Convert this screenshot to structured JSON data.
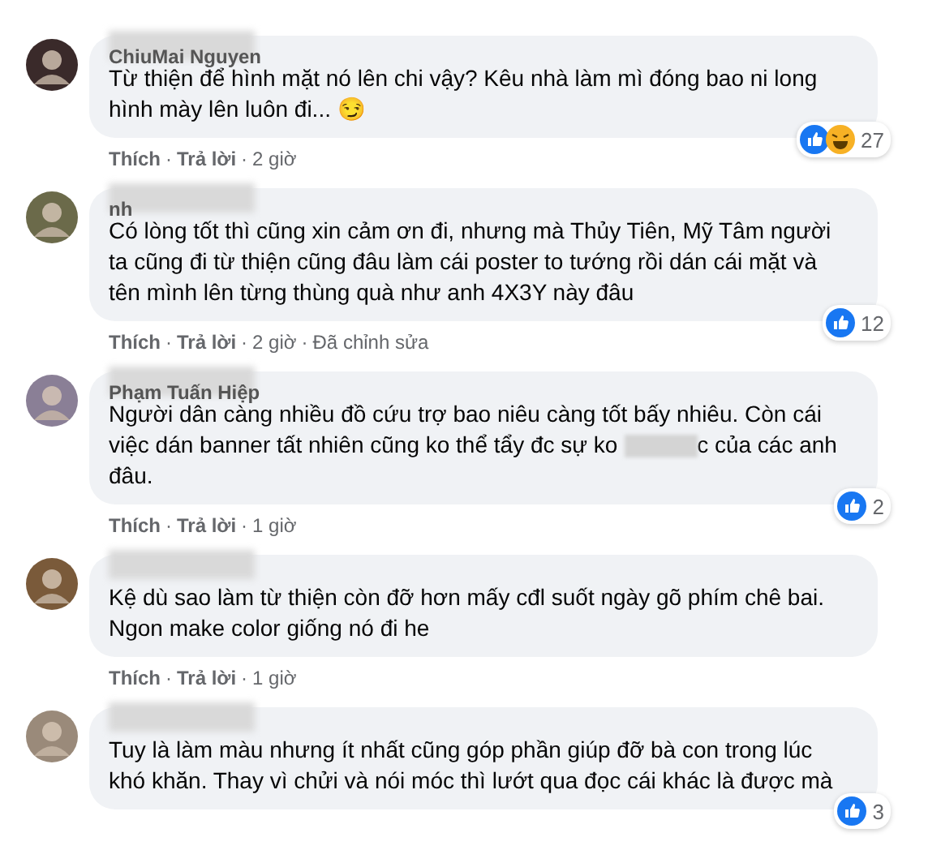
{
  "comments": [
    {
      "author": "ChiuMai Nguyen",
      "body": [
        {
          "kind": "text",
          "text": "Từ thiện để hình mặt nó lên chi vậy? Kêu nhà làm mì đóng bao ni long hình mày lên luôn đi... 😏"
        }
      ],
      "reactions": [
        {
          "kind": "like"
        },
        {
          "kind": "haha"
        }
      ],
      "count": "27",
      "separator": "·",
      "actions": [
        "Thích",
        "Trả lời",
        "2 giờ"
      ]
    },
    {
      "author": "nh",
      "body": [
        {
          "kind": "text",
          "text": "Có lòng tốt thì cũng xin cảm ơn đi, nhưng mà Thủy Tiên, Mỹ Tâm người ta cũng đi từ thiện cũng đâu làm cái poster to tướng rồi dán cái mặt và tên mình lên từng thùng quà như anh 4X3Y này đâu"
        }
      ],
      "reactions": [
        {
          "kind": "like"
        }
      ],
      "count": "12",
      "separator": "·",
      "actions": [
        "Thích",
        "Trả lời",
        "2 giờ",
        "Đã chỉnh sửa"
      ]
    },
    {
      "author": "Phạm Tuấn Hiệp",
      "body": [
        {
          "kind": "text",
          "text": "Người dân càng nhiều đồ cứu trợ bao niêu càng tốt bấy nhiêu. Còn cái việc dán banner tất nhiên cũng ko thể tẩy đc sự ko "
        },
        {
          "kind": "censor"
        },
        {
          "kind": "text",
          "text": "c của các anh đâu."
        }
      ],
      "reactions": [
        {
          "kind": "like"
        }
      ],
      "count": "2",
      "separator": "·",
      "actions": [
        "Thích",
        "Trả lời",
        "1 giờ"
      ]
    },
    {
      "body": [
        {
          "kind": "text",
          "text": "Kệ dù sao làm từ thiện còn đỡ hơn mấy cđl suốt ngày gõ phím chê bai. Ngon make color giống nó đi he"
        }
      ],
      "separator": "·",
      "actions": [
        "Thích",
        "Trả lời",
        "1 giờ"
      ]
    },
    {
      "body": [
        {
          "kind": "text",
          "text": "Tuy là làm màu nhưng ít nhất cũng góp phần giúp đỡ bà con trong lúc khó khăn. Thay vì chửi và nói móc thì lướt qua đọc cái khác là được mà"
        }
      ],
      "reactions": [
        {
          "kind": "like"
        }
      ],
      "count": "3"
    }
  ]
}
